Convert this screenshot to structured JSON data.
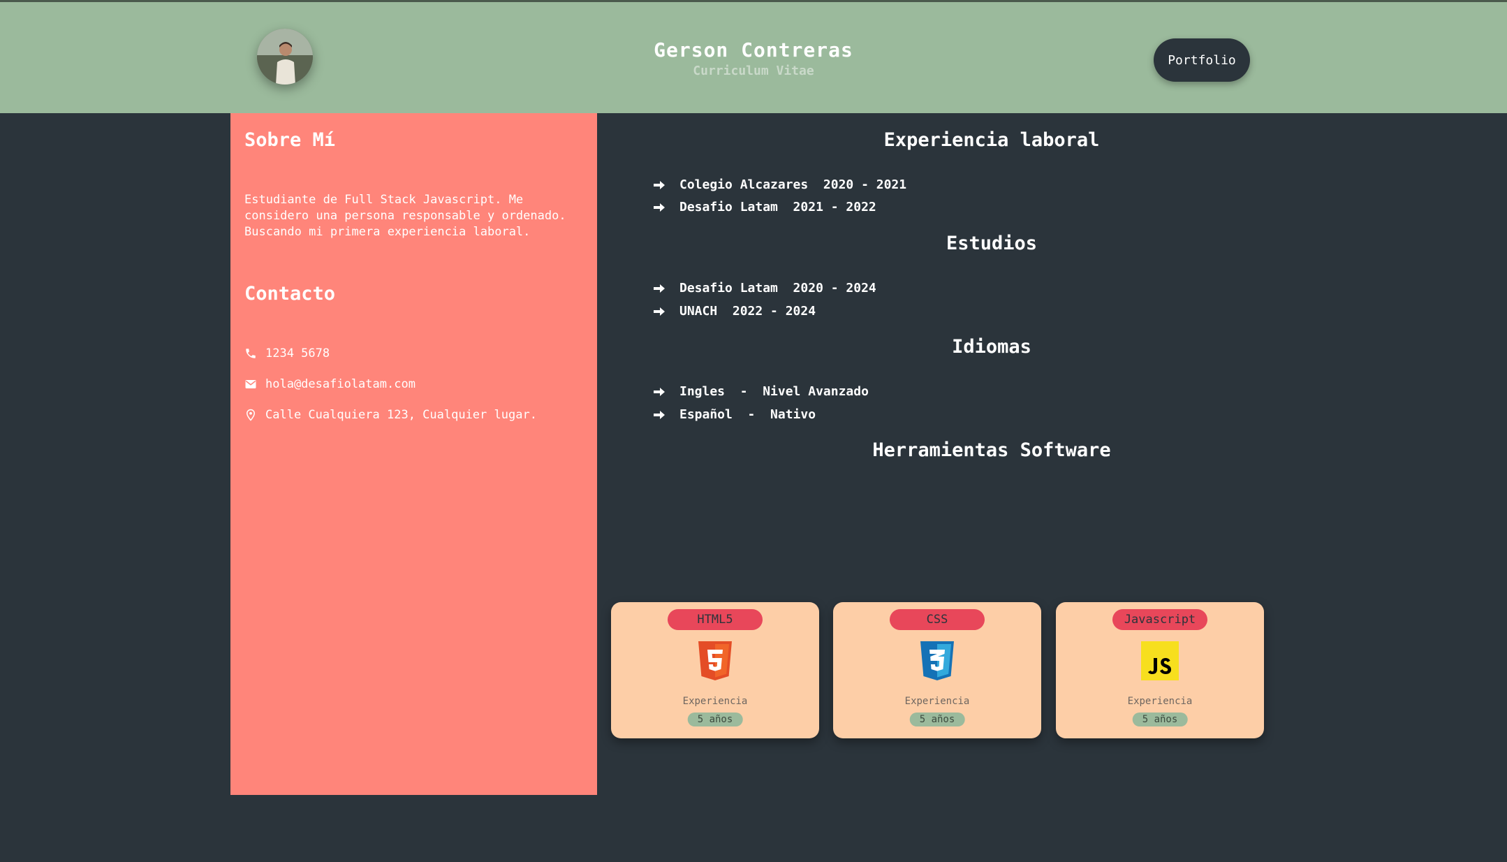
{
  "header": {
    "name": "Gerson Contreras",
    "subtitle": "Curriculum Vitae",
    "portfolio_label": "Portfolio"
  },
  "sidebar": {
    "about_title": "Sobre Mí",
    "about_text": "Estudiante de Full Stack Javascript. Me considero una persona responsable y ordenado. Buscando mi primera experiencia laboral.",
    "contact_title": "Contacto",
    "contact": [
      {
        "icon": "phone-icon",
        "value": "1234 5678"
      },
      {
        "icon": "mail-icon",
        "value": "hola@desafiolatam.com"
      },
      {
        "icon": "location-pin-icon",
        "value": "Calle Cualquiera 123, Cualquier lugar."
      }
    ]
  },
  "main": {
    "experience": {
      "title": "Experiencia laboral",
      "items": [
        {
          "text": "Colegio Alcazares  2020 - 2021"
        },
        {
          "text": "Desafio Latam  2021 - 2022"
        }
      ]
    },
    "studies": {
      "title": "Estudios",
      "items": [
        {
          "text": "Desafio Latam  2020 - 2024"
        },
        {
          "text": "UNACH  2022 - 2024"
        }
      ]
    },
    "languages": {
      "title": "Idiomas",
      "items": [
        {
          "text": "Ingles  -  Nivel Avanzado"
        },
        {
          "text": "Español  -  Nativo"
        }
      ]
    },
    "tools": {
      "title": "Herramientas Software",
      "cards": [
        {
          "name": "HTML5",
          "icon": "html5-icon",
          "exp_label": "Experiencia",
          "years": "5 años"
        },
        {
          "name": "CSS",
          "icon": "css3-icon",
          "exp_label": "Experiencia",
          "years": "5 años"
        },
        {
          "name": "Javascript",
          "icon": "javascript-icon",
          "exp_label": "Experiencia",
          "years": "5 años"
        }
      ]
    }
  },
  "colors": {
    "header_bg": "#9bba9c",
    "page_bg": "#2b343b",
    "sidebar_bg": "#ff857a",
    "card_bg": "#fdcea7",
    "pill_bg": "#e8475a"
  }
}
